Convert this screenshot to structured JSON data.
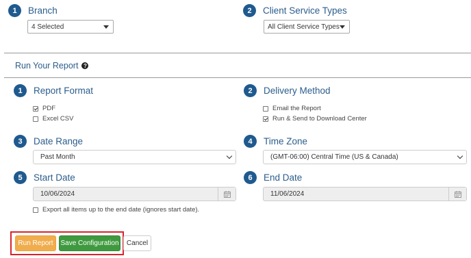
{
  "branch": {
    "step": "1",
    "label": "Branch",
    "selected": "4 Selected"
  },
  "client_service_types": {
    "step": "2",
    "label": "Client Service Types",
    "selected": "All Client Service Types"
  },
  "run_report": {
    "title": "Run Your Report",
    "help_icon": "question-circle-icon"
  },
  "report_format": {
    "step": "1",
    "label": "Report Format",
    "options": [
      {
        "label": "PDF",
        "checked": true
      },
      {
        "label": "Excel CSV",
        "checked": false
      }
    ]
  },
  "delivery_method": {
    "step": "2",
    "label": "Delivery Method",
    "options": [
      {
        "label": "Email the Report",
        "checked": false
      },
      {
        "label": "Run & Send to Download Center",
        "checked": true
      }
    ]
  },
  "date_range": {
    "step": "3",
    "label": "Date Range",
    "selected": "Past Month"
  },
  "time_zone": {
    "step": "4",
    "label": "Time Zone",
    "selected": "(GMT-06:00) Central Time (US & Canada)"
  },
  "start_date": {
    "step": "5",
    "label": "Start Date",
    "value": "10/06/2024"
  },
  "end_date": {
    "step": "6",
    "label": "End Date",
    "value": "11/06/2024"
  },
  "export_all": {
    "label": "Export all items up to the end date (ignores start date).",
    "checked": false
  },
  "buttons": {
    "run": "Run Report",
    "save": "Save Configuration",
    "cancel": "Cancel"
  },
  "colors": {
    "primary": "#1f5a8f",
    "run_button": "#f0ad4e",
    "save_button": "#3f9a3f",
    "highlight": "#d9232d"
  }
}
